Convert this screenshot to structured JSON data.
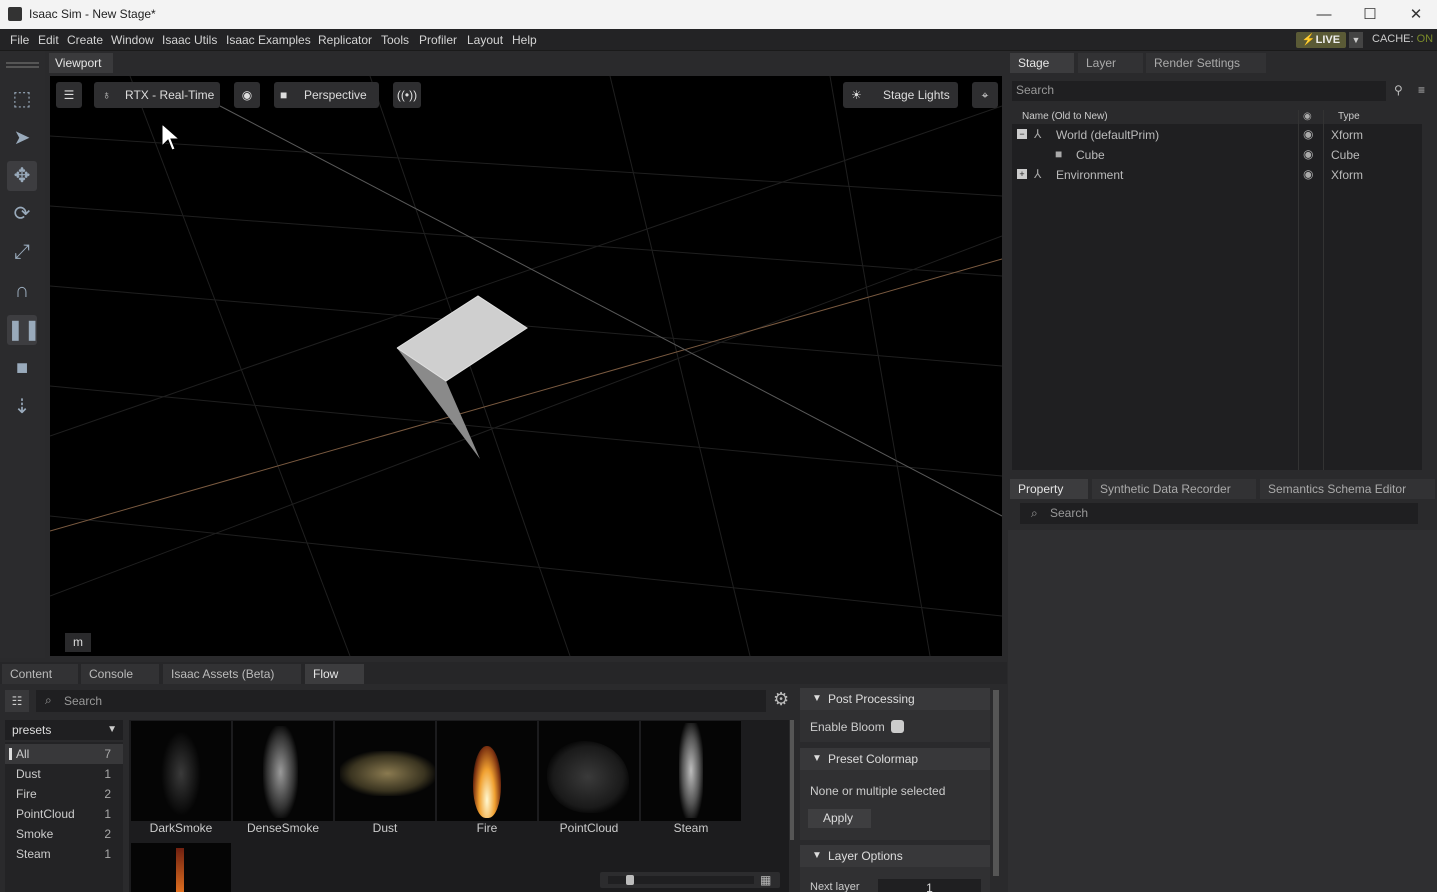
{
  "window": {
    "title": "Isaac Sim  - New Stage*",
    "minimize": "—",
    "maximize": "☐",
    "close": "✕"
  },
  "menu": [
    "File",
    "Edit",
    "Create",
    "Window",
    "Isaac Utils",
    "Isaac Examples",
    "Replicator",
    "Tools",
    "Profiler",
    "Layout",
    "Help"
  ],
  "status": {
    "live": "LIVE",
    "cache_label": "CACHE:",
    "cache_value": "ON"
  },
  "viewport": {
    "tab": "Viewport",
    "renderer": "RTX - Real-Time",
    "camera": "Perspective",
    "lights": "Stage Lights",
    "units_label": "m"
  },
  "stage": {
    "tabs": [
      "Stage",
      "Layer",
      "Render Settings"
    ],
    "search_placeholder": "Search",
    "col_name": "Name (Old to New)",
    "col_type": "Type",
    "rows": [
      {
        "name": "World (defaultPrim)",
        "type": "Xform"
      },
      {
        "name": "Cube",
        "type": "Cube"
      },
      {
        "name": "Environment",
        "type": "Xform"
      }
    ]
  },
  "property": {
    "tabs": [
      "Property",
      "Synthetic Data Recorder",
      "Semantics Schema Editor"
    ],
    "search_placeholder": "Search"
  },
  "bottom": {
    "tabs": [
      "Content",
      "Console",
      "Isaac Assets (Beta)",
      "Flow"
    ],
    "search_placeholder": "Search",
    "presets_dropdown": "presets",
    "preset_list": [
      {
        "name": "All",
        "count": "7"
      },
      {
        "name": "Dust",
        "count": "1"
      },
      {
        "name": "Fire",
        "count": "2"
      },
      {
        "name": "PointCloud",
        "count": "1"
      },
      {
        "name": "Smoke",
        "count": "2"
      },
      {
        "name": "Steam",
        "count": "1"
      }
    ],
    "thumbnails": [
      "DarkSmoke",
      "DenseSmoke",
      "Dust",
      "Fire",
      "PointCloud",
      "Steam"
    ],
    "post_processing": {
      "title": "Post Processing",
      "enable_bloom": "Enable Bloom"
    },
    "preset_colormap": {
      "title": "Preset Colormap",
      "status": "None or multiple selected",
      "apply": "Apply"
    },
    "layer_options": {
      "title": "Layer Options",
      "next_layer_label": "Next layer",
      "next_layer_value": "1"
    }
  }
}
